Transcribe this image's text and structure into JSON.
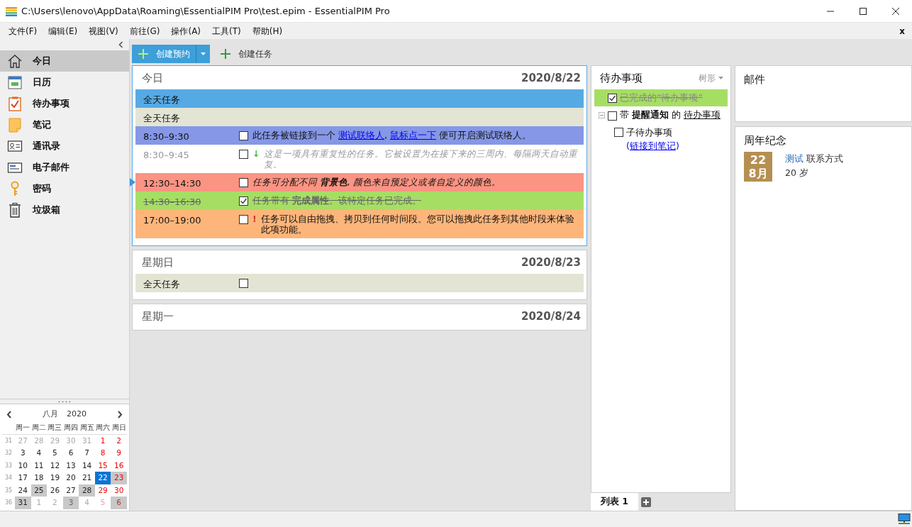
{
  "window": {
    "title": "C:\\Users\\lenovo\\AppData\\Roaming\\EssentialPIM Pro\\test.epim - EssentialPIM Pro"
  },
  "menu": [
    "文件(F)",
    "编辑(E)",
    "视图(V)",
    "前往(G)",
    "操作(A)",
    "工具(T)",
    "帮助(H)"
  ],
  "menu_close": "x",
  "sidebar": {
    "items": [
      {
        "label": "今日",
        "selected": true
      },
      {
        "label": "日历",
        "selected": false
      },
      {
        "label": "待办事项",
        "selected": false
      },
      {
        "label": "笔记",
        "selected": false
      },
      {
        "label": "通讯录",
        "selected": false
      },
      {
        "label": "电子邮件",
        "selected": false
      },
      {
        "label": "密码",
        "selected": false
      },
      {
        "label": "垃圾箱",
        "selected": false
      }
    ]
  },
  "calendar": {
    "month": "八月",
    "year": "2020",
    "weekdays": [
      "周一",
      "周二",
      "周三",
      "周四",
      "周五",
      "周六",
      "周日"
    ],
    "weeks": [
      {
        "num": "31",
        "days": [
          {
            "d": "27",
            "other": true,
            "busy": false,
            "selected": false
          },
          {
            "d": "28",
            "other": true,
            "busy": false,
            "selected": false
          },
          {
            "d": "29",
            "other": true,
            "busy": false,
            "selected": false
          },
          {
            "d": "30",
            "other": true,
            "busy": false,
            "selected": false
          },
          {
            "d": "31",
            "other": true,
            "busy": false,
            "selected": false
          },
          {
            "d": "1",
            "other": false,
            "busy": false,
            "selected": false
          },
          {
            "d": "2",
            "other": false,
            "busy": false,
            "selected": false
          }
        ]
      },
      {
        "num": "32",
        "days": [
          {
            "d": "3",
            "other": false,
            "busy": false,
            "selected": false
          },
          {
            "d": "4",
            "other": false,
            "busy": false,
            "selected": false
          },
          {
            "d": "5",
            "other": false,
            "busy": false,
            "selected": false
          },
          {
            "d": "6",
            "other": false,
            "busy": false,
            "selected": false
          },
          {
            "d": "7",
            "other": false,
            "busy": false,
            "selected": false
          },
          {
            "d": "8",
            "other": false,
            "busy": false,
            "selected": false
          },
          {
            "d": "9",
            "other": false,
            "busy": false,
            "selected": false
          }
        ]
      },
      {
        "num": "33",
        "days": [
          {
            "d": "10",
            "other": false,
            "busy": false,
            "selected": false
          },
          {
            "d": "11",
            "other": false,
            "busy": false,
            "selected": false
          },
          {
            "d": "12",
            "other": false,
            "busy": false,
            "selected": false
          },
          {
            "d": "13",
            "other": false,
            "busy": false,
            "selected": false
          },
          {
            "d": "14",
            "other": false,
            "busy": false,
            "selected": false
          },
          {
            "d": "15",
            "other": false,
            "busy": false,
            "selected": false
          },
          {
            "d": "16",
            "other": false,
            "busy": false,
            "selected": false
          }
        ]
      },
      {
        "num": "34",
        "days": [
          {
            "d": "17",
            "other": false,
            "busy": false,
            "selected": false
          },
          {
            "d": "18",
            "other": false,
            "busy": false,
            "selected": false
          },
          {
            "d": "19",
            "other": false,
            "busy": false,
            "selected": false
          },
          {
            "d": "20",
            "other": false,
            "busy": false,
            "selected": false
          },
          {
            "d": "21",
            "other": false,
            "busy": false,
            "selected": false
          },
          {
            "d": "22",
            "other": false,
            "busy": false,
            "selected": true
          },
          {
            "d": "23",
            "other": false,
            "busy": true,
            "selected": false
          }
        ]
      },
      {
        "num": "35",
        "days": [
          {
            "d": "24",
            "other": false,
            "busy": false,
            "selected": false
          },
          {
            "d": "25",
            "other": false,
            "busy": true,
            "selected": false
          },
          {
            "d": "26",
            "other": false,
            "busy": false,
            "selected": false
          },
          {
            "d": "27",
            "other": false,
            "busy": false,
            "selected": false
          },
          {
            "d": "28",
            "other": false,
            "busy": true,
            "selected": false
          },
          {
            "d": "29",
            "other": false,
            "busy": false,
            "selected": false
          },
          {
            "d": "30",
            "other": false,
            "busy": false,
            "selected": false
          }
        ]
      },
      {
        "num": "36",
        "days": [
          {
            "d": "31",
            "other": false,
            "busy": true,
            "selected": false
          },
          {
            "d": "1",
            "other": true,
            "busy": false,
            "selected": false
          },
          {
            "d": "2",
            "other": true,
            "busy": false,
            "selected": false
          },
          {
            "d": "3",
            "other": true,
            "busy": true,
            "selected": false
          },
          {
            "d": "4",
            "other": true,
            "busy": false,
            "selected": false
          },
          {
            "d": "5",
            "other": true,
            "busy": false,
            "selected": false
          },
          {
            "d": "6",
            "other": true,
            "busy": true,
            "selected": false
          }
        ]
      }
    ]
  },
  "toolbar": [
    {
      "label": "创建预约",
      "dropdown": true
    },
    {
      "label": "创建任务",
      "dropdown": false
    }
  ],
  "days": [
    {
      "title": "今日",
      "date": "2020/8/22",
      "selected": true,
      "rows": [
        {
          "kind": "allday",
          "time": "全天任务",
          "color": "#55aae4",
          "now": false
        },
        {
          "kind": "allday",
          "time": "全天任务",
          "color": "#e4e4d4",
          "now": false
        },
        {
          "kind": "plain",
          "time": "8:30–9:30",
          "color": "#8597e6",
          "now": false,
          "checked": false,
          "parts": [
            {
              "kind": "text",
              "text": "此任务被链接到一个 "
            },
            {
              "kind": "link",
              "text": "测试联络人"
            },
            {
              "kind": "text",
              "text": ", "
            },
            {
              "kind": "link",
              "text": "鼠标点一下"
            },
            {
              "kind": "text",
              "text": " 便可开启测试联络人。"
            }
          ]
        },
        {
          "kind": "recurring",
          "time": "8:30–9:45",
          "color": "#ffffff",
          "now": false,
          "checked": false,
          "marker": "↓",
          "parts": [
            {
              "kind": "text",
              "text": "这是一项具有重复性的任务。它被设置为在接下来的三周内、每隔两天自动重复。"
            }
          ]
        },
        {
          "kind": "emphasis",
          "time": "12:30–14:30",
          "color": "#fb9483",
          "now": true,
          "checked": false,
          "parts": [
            {
              "kind": "text",
              "text": "任务可分配不同 "
            },
            {
              "kind": "bold",
              "text": "背景色"
            },
            {
              "kind": "text",
              "text": ", 颜色来自预定义或者自定义的颜色。"
            }
          ]
        },
        {
          "kind": "plain",
          "time": "14:30–16:30",
          "color": "#a6de64",
          "now": false,
          "checked": true,
          "parts": [
            {
              "kind": "text",
              "text": "任务带有 "
            },
            {
              "kind": "bold",
              "text": "完成属性"
            },
            {
              "kind": "text",
              "text": "。该特定任务已完成。"
            }
          ]
        },
        {
          "kind": "plain",
          "time": "17:00–19:00",
          "color": "#fdb57a",
          "now": false,
          "checked": false,
          "marker": "!",
          "parts": [
            {
              "kind": "text",
              "text": "任务可以自由拖拽、拷贝到任何时间段。您可以拖拽此任务到其他时段来体验此项功能。"
            }
          ]
        }
      ]
    },
    {
      "title": "星期日",
      "date": "2020/8/23",
      "selected": false,
      "rows": [
        {
          "kind": "allday",
          "time": "全天任务",
          "color": "#e4e4d4",
          "now": false,
          "checked": false
        }
      ]
    },
    {
      "title": "星期一",
      "date": "2020/8/24",
      "selected": false
    }
  ],
  "todo": {
    "title": "待办事项",
    "view": "树形",
    "items": [
      {
        "checked": true,
        "parts": [
          {
            "kind": "text",
            "text": "已完成的“待办事项”"
          }
        ]
      },
      {
        "checked": false,
        "expanded": true,
        "parts": [
          {
            "kind": "text",
            "text": "带 "
          },
          {
            "kind": "bold",
            "text": "提醒通知"
          },
          {
            "kind": "text",
            "text": " 的 "
          },
          {
            "kind": "underline",
            "text": "待办事项"
          }
        ],
        "children": [
          {
            "checked": false,
            "parts": [
              {
                "kind": "text",
                "text": "子待办事项"
              }
            ],
            "note": [
              {
                "kind": "text",
                "text": "("
              },
              {
                "kind": "link",
                "text": "链接到笔记"
              },
              {
                "kind": "text",
                "text": ")"
              }
            ]
          }
        ]
      }
    ],
    "tabs": [
      {
        "label": "列表 1",
        "selected": true
      }
    ]
  },
  "mail": {
    "title": "邮件"
  },
  "anniversary": {
    "title": "周年纪念",
    "entries": [
      {
        "day": "22",
        "month": "8月",
        "name": "测试",
        "type": "联系方式",
        "age": "20 岁"
      }
    ]
  }
}
